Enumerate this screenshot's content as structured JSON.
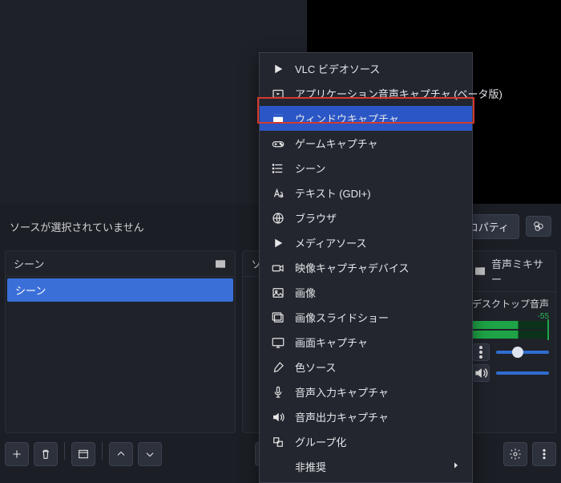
{
  "status": {
    "no_selection": "ソースが選択されていません",
    "properties_btn": "プロパティ"
  },
  "panels": {
    "scenes_title": "シーン",
    "sources_title": "ソ",
    "mixer_title": "音声ミキサー",
    "scene_item": "シーン",
    "mix_channel": "デスクトップ音声",
    "db_value": "-55"
  },
  "ctx": {
    "items": [
      "VLC ビデオソース",
      "アプリケーション音声キャプチャ (ベータ版)",
      "ウィンドウキャプチャ",
      "ゲームキャプチャ",
      "シーン",
      "テキスト (GDI+)",
      "ブラウザ",
      "メディアソース",
      "映像キャプチャデバイス",
      "画像",
      "画像スライドショー",
      "画面キャプチャ",
      "色ソース",
      "音声入力キャプチャ",
      "音声出力キャプチャ",
      "グループ化",
      "非推奨"
    ]
  }
}
